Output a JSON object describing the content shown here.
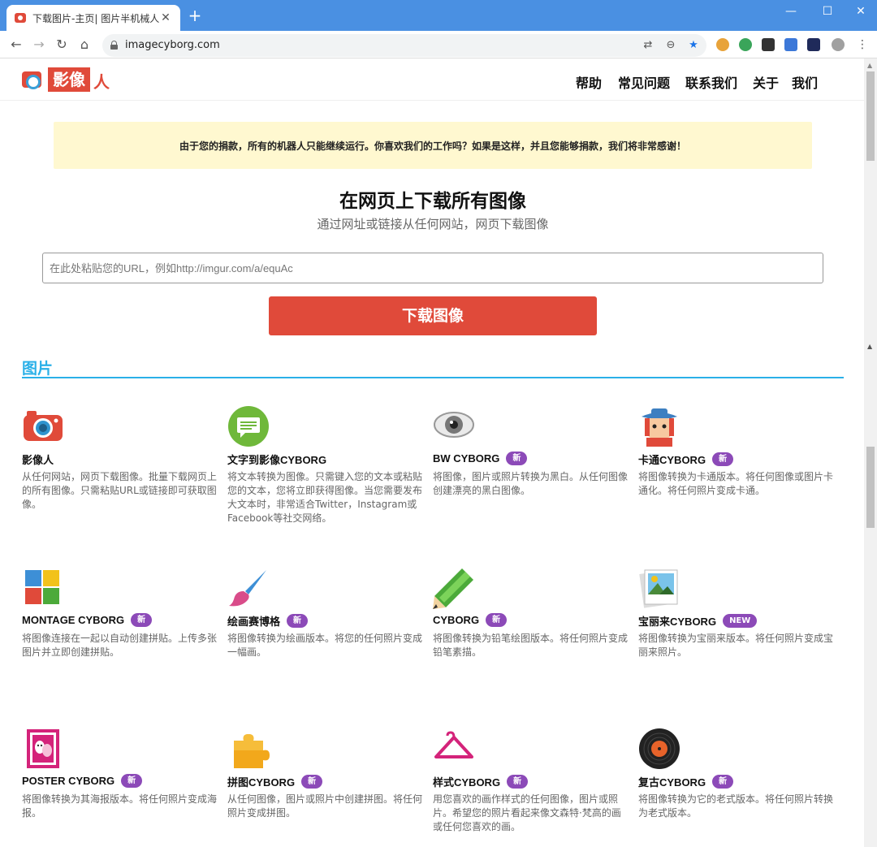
{
  "browser": {
    "tab_title": "下载图片-主页| 图片半机械人",
    "tab_close": "✕",
    "new_tab": "+",
    "url": "imagecyborg.com",
    "window_controls": {
      "minimize": "—",
      "maximize": "☐",
      "close": "✕"
    }
  },
  "header": {
    "logo_box": "影像",
    "logo_text": "人",
    "nav": [
      "帮助",
      "常见问题",
      "联系我们",
      "关于",
      "我们"
    ]
  },
  "banner": {
    "text": "由于您的捐款，所有的机器人只能继续运行。你喜欢我们的工作吗？如果是这样，并且您能够捐款，我们将非常感谢！"
  },
  "hero": {
    "title": "在网页上下载所有图像",
    "subtitle": "通过网址或链接从任何网站，网页下载图像",
    "input_placeholder": "在此处粘贴您的URL，例如http://imgur.com/a/equAc",
    "button": "下载图像"
  },
  "section": {
    "title": "图片"
  },
  "cards": [
    {
      "title": "影像人",
      "badge": "",
      "desc": "从任何网站，网页下载图像。批量下载网页上的所有图像。只需粘贴URL或链接即可获取图像。",
      "icon": "camera-icon"
    },
    {
      "title": "文字到影像CYBORG",
      "badge": "",
      "desc": "将文本转换为图像。只需键入您的文本或粘贴您的文本，您将立即获得图像。当您需要发布大文本时，非常适合Twitter，Instagram或Facebook等社交网络。",
      "icon": "chat-bubble-icon"
    },
    {
      "title": "BW CYBORG",
      "badge": "新",
      "desc": "将图像，图片或照片转换为黑白。从任何图像创建漂亮的黑白图像。",
      "icon": "eye-icon"
    },
    {
      "title": "卡通CYBORG",
      "badge": "新",
      "desc": "将图像转换为卡通版本。将任何图像或图片卡通化。将任何照片变成卡通。",
      "icon": "cartoon-character-icon"
    },
    {
      "title": "MONTAGE CYBORG",
      "badge": "新",
      "desc": "将图像连接在一起以自动创建拼贴。上传多张图片并立即创建拼贴。",
      "icon": "montage-grid-icon"
    },
    {
      "title": "绘画赛博格",
      "badge": "新",
      "desc": "将图像转换为绘画版本。将您的任何照片变成一幅画。",
      "icon": "paintbrush-icon"
    },
    {
      "title": "CYBORG",
      "badge": "新",
      "desc": "将图像转换为铅笔绘图版本。将任何照片变成铅笔素描。",
      "icon": "pencil-icon"
    },
    {
      "title": "宝丽来CYBORG",
      "badge": "NEW",
      "desc": "将图像转换为宝丽来版本。将任何照片变成宝丽来照片。",
      "icon": "polaroid-icon"
    },
    {
      "title": "POSTER CYBORG",
      "badge": "新",
      "desc": "将图像转换为其海报版本。将任何照片变成海报。",
      "icon": "poster-masks-icon"
    },
    {
      "title": "拼图CYBORG",
      "badge": "新",
      "desc": "从任何图像，图片或照片中创建拼图。将任何照片变成拼图。",
      "icon": "puzzle-icon"
    },
    {
      "title": "样式CYBORG",
      "badge": "新",
      "desc": "用您喜欢的画作样式的任何图像，图片或照片。希望您的照片看起来像文森特·梵高的画或任何您喜欢的画。",
      "icon": "hanger-icon"
    },
    {
      "title": "复古CYBORG",
      "badge": "新",
      "desc": "将图像转换为它的老式版本。将任何照片转换为老式版本。",
      "icon": "vinyl-record-icon"
    }
  ]
}
